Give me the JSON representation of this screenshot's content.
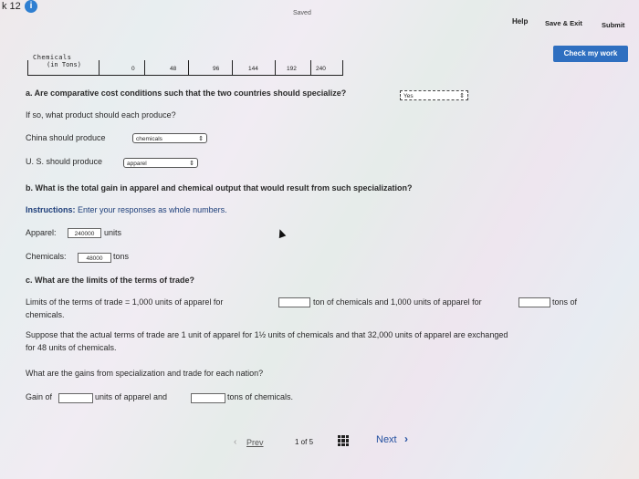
{
  "header": {
    "question_number": "k 12",
    "info_icon": "i",
    "saved": "Saved",
    "help": "Help",
    "save_exit": "Save & Exit",
    "submit": "Submit",
    "check_my_work": "Check my work"
  },
  "table": {
    "label_line1": "Chemicals",
    "label_line2": "(in Tons)",
    "ticks": [
      "0",
      "48",
      "96",
      "144",
      "192",
      "240"
    ]
  },
  "part_a": {
    "question": "a. Are comparative cost conditions such that the two countries should specialize?",
    "answer_select": "Yes",
    "followup": "If so, what product should each produce?",
    "china_label": "China should produce",
    "china_value": "chemicals",
    "us_label": "U. S. should produce",
    "us_value": "apparel"
  },
  "part_b": {
    "question": "b. What is the total gain in apparel and chemical output that would result from such specialization?",
    "instructions_label": "Instructions:",
    "instructions_text": "Enter your responses as whole numbers.",
    "apparel_label": "Apparel:",
    "apparel_value": "240000",
    "apparel_unit": "units",
    "chemicals_label": "Chemicals:",
    "chemicals_value": "48000",
    "chemicals_unit": "tons"
  },
  "part_c": {
    "question": "c. What are the limits of the terms of trade?",
    "limits_text1": "Limits of the terms of trade = 1,000 units of apparel for",
    "limits_text2": "ton of chemicals and 1,000 units of apparel for",
    "limits_text3": "tons of",
    "limits_text4": "chemicals.",
    "suppose_line1": "Suppose that the actual terms of trade are 1 unit of apparel for 1½ units of chemicals and that 32,000 units of apparel are exchanged",
    "suppose_line2": "for 48 units of chemicals.",
    "gains_question": "What are the gains from specialization and trade for each nation?",
    "gain_of": "Gain of",
    "units_apparel_and": "units of apparel and",
    "tons_chemicals": "tons of chemicals."
  },
  "footer": {
    "prev": "Prev",
    "page": "1 of 5",
    "next": "Next"
  }
}
